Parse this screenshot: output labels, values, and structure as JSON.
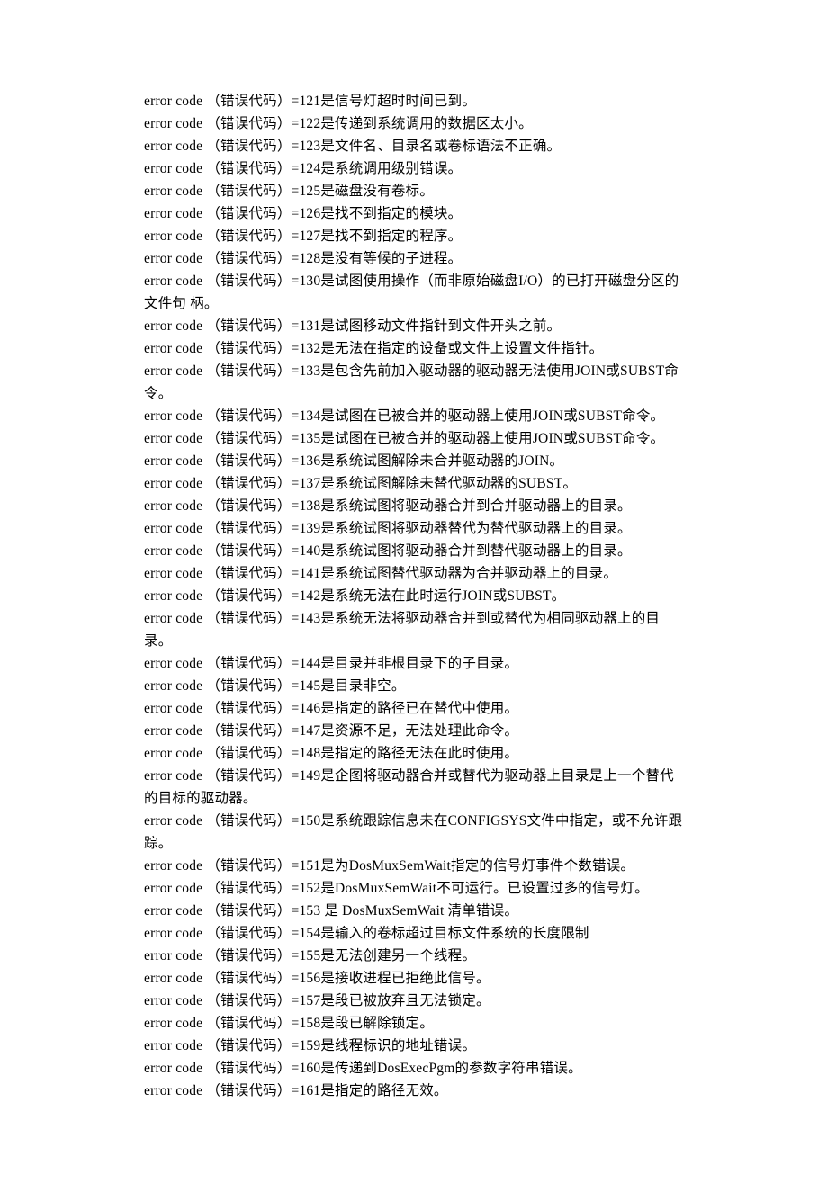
{
  "lines": [
    "error code （错误代码）=121是信号灯超时时间已到。",
    "error code （错误代码）=122是传递到系统调用的数据区太小。",
    "error code （错误代码）=123是文件名、目录名或卷标语法不正确。",
    "error code （错误代码）=124是系统调用级别错误。",
    "error code （错误代码）=125是磁盘没有卷标。",
    "error code （错误代码）=126是找不到指定的模块。",
    "error code （错误代码）=127是找不到指定的程序。",
    "error code （错误代码）=128是没有等候的子进程。",
    "error code （错误代码）=130是试图使用操作（而非原始磁盘I/O）的已打开磁盘分区的文件句 柄。",
    "error code （错误代码）=131是试图移动文件指针到文件开头之前。",
    "error code （错误代码）=132是无法在指定的设备或文件上设置文件指针。",
    "error code （错误代码）=133是包含先前加入驱动器的驱动器无法使用JOIN或SUBST命  令。",
    "error code （错误代码）=134是试图在已被合并的驱动器上使用JOIN或SUBST命令。",
    "error code （错误代码）=135是试图在已被合并的驱动器上使用JOIN或SUBST命令。  error code （错误代码）=136是系统试图解除未合并驱动器的JOIN。",
    "error code （错误代码）=137是系统试图解除未替代驱动器的SUBST。",
    "error code （错误代码）=138是系统试图将驱动器合并到合并驱动器上的目录。",
    "error code （错误代码）=139是系统试图将驱动器替代为替代驱动器上的目录。",
    "error code （错误代码）=140是系统试图将驱动器合并到替代驱动器上的目录。",
    "error code （错误代码）=141是系统试图替代驱动器为合并驱动器上的目录。",
    "error code （错误代码）=142是系统无法在此时运行JOIN或SUBST。",
    "error code （错误代码）=143是系统无法将驱动器合并到或替代为相同驱动器上的目录。",
    "error code （错误代码）=144是目录并非根目录下的子目录。",
    "error code （错误代码）=145是目录非空。",
    "error code （错误代码）=146是指定的路径已在替代中使用。",
    "error code （错误代码）=147是资源不足，无法处理此命令。",
    "error code （错误代码）=148是指定的路径无法在此时使用。",
    "error code （错误代码）=149是企图将驱动器合并或替代为驱动器上目录是上一个替代的目标的驱动器。",
    "error code （错误代码）=150是系统跟踪信息未在CONFIGSYS文件中指定，或不允许跟踪。",
    "error code （错误代码）=151是为DosMuxSemWait指定的信号灯事件个数错误。",
    "error code （错误代码）=152是DosMuxSemWait不可运行。已设置过多的信号灯。",
    "error code （错误代码）=153 是  DosMuxSemWait 清单错误。",
    "error code （错误代码）=154是输入的卷标超过目标文件系统的长度限制",
    "error code （错误代码）=155是无法创建另一个线程。",
    "error code （错误代码）=156是接收进程已拒绝此信号。",
    "error code （错误代码）=157是段已被放弃且无法锁定。",
    "error code （错误代码）=158是段已解除锁定。",
    "error code （错误代码）=159是线程标识的地址错误。",
    "error code （错误代码）=160是传递到DosExecPgm的参数字符串错误。",
    "error code （错误代码）=161是指定的路径无效。"
  ]
}
